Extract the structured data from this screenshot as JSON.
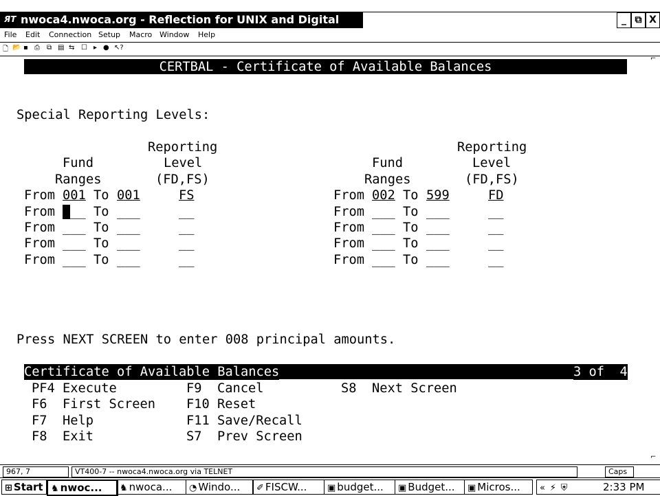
{
  "window": {
    "title": "nwoca4.nwoca.org - Reflection for UNIX and Digital",
    "icon_text": "ЯT",
    "controls": [
      "_",
      "⧉",
      "X"
    ]
  },
  "menu": [
    "File",
    "Edit",
    "Connection",
    "Setup",
    "Macro",
    "Window",
    "Help"
  ],
  "toolbar_icons": [
    "new-icon",
    "open-icon",
    "save-icon",
    "print-icon",
    "copy-icon",
    "paste-icon",
    "connect-icon",
    "setup-icon",
    "play-icon",
    "record-icon",
    "help-icon"
  ],
  "terminal": {
    "header": "CERTBAL - Certificate of Available Balances",
    "section_label": "Special Reporting Levels:",
    "col_headers": {
      "fund": "Fund",
      "ranges": "Ranges",
      "reporting": "Reporting",
      "level": "Level",
      "level_codes": "(FD,FS)"
    },
    "from_label": "From",
    "to_label": "To",
    "left_rows": [
      {
        "from": "001",
        "to": "001",
        "level": "FS"
      },
      {
        "from": "___",
        "to": "___",
        "level": "__"
      },
      {
        "from": "___",
        "to": "___",
        "level": "__"
      },
      {
        "from": "___",
        "to": "___",
        "level": "__"
      },
      {
        "from": "___",
        "to": "___",
        "level": "__"
      }
    ],
    "right_rows": [
      {
        "from": "002",
        "to": "599",
        "level": "FD"
      },
      {
        "from": "___",
        "to": "___",
        "level": "__"
      },
      {
        "from": "___",
        "to": "___",
        "level": "__"
      },
      {
        "from": "___",
        "to": "___",
        "level": "__"
      },
      {
        "from": "___",
        "to": "___",
        "level": "__"
      }
    ],
    "message": "Press NEXT SCREEN to enter 008 principal amounts.",
    "footer_title": "Certificate of Available Balances",
    "page_indicator": "3 of  4",
    "keys": {
      "pf4": "PF4 Execute",
      "f6": "F6  First Screen",
      "f7": "F7  Help",
      "f8": "F8  Exit",
      "f9": "F9  Cancel",
      "f10": "F10 Reset",
      "f11": "F11 Save/Recall",
      "s7": "S7  Prev Screen",
      "s8": "S8  Next Screen"
    }
  },
  "status": {
    "cursor_pos": "967, 7",
    "connection": "VT400-7 -- nwoca4.nwoca.org via TELNET",
    "caps": "Caps"
  },
  "taskbar": {
    "start": "Start",
    "tasks": [
      "nwoc...",
      "nwoca...",
      "Windo...",
      "FISCW...",
      "budget...",
      "Budget...",
      "Micros..."
    ],
    "clock": "2:33 PM"
  }
}
